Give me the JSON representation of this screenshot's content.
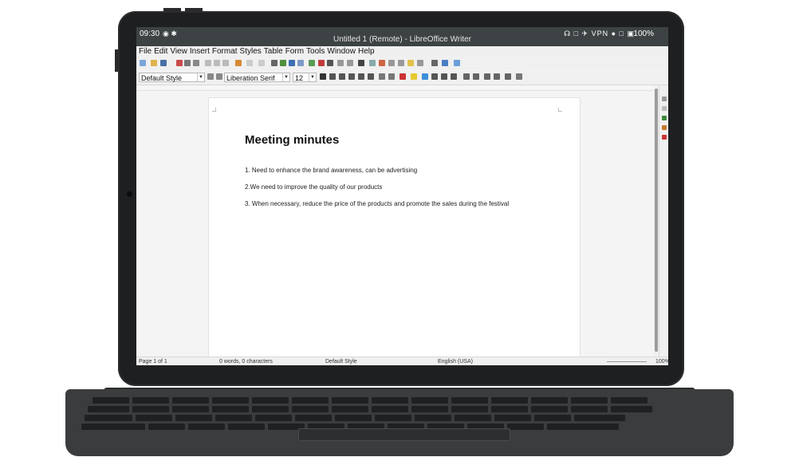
{
  "status_bar": {
    "time": "09:30",
    "battery": "100%",
    "vpn": "VPN"
  },
  "window": {
    "title": "Untitled 1 (Remote) - LibreOffice Writer"
  },
  "menu": [
    "File",
    "Edit",
    "View",
    "Insert",
    "Format",
    "Styles",
    "Table",
    "Form",
    "Tools",
    "Window",
    "Help"
  ],
  "formatting": {
    "paragraph_style": "Default Style",
    "font_name": "Liberation Serif",
    "font_size": "12"
  },
  "document": {
    "heading": "Meeting minutes",
    "items": [
      "1. Need to enhance the brand awareness, can be advertising",
      "2.We need to improve the quality of our products",
      "3. When necessary, reduce the price of the products and promote the sales during the festival"
    ]
  },
  "statusline": {
    "page": "Page 1 of 1",
    "words": "0 words, 0 characters",
    "style": "Default Style",
    "language": "English (USA)",
    "zoom": "100%"
  },
  "colors": {
    "bezel": "#1e1f21",
    "statusbar": "#3d4244",
    "toolbar": "#f0f0f0",
    "highlight_button": "#3c8fd9"
  }
}
